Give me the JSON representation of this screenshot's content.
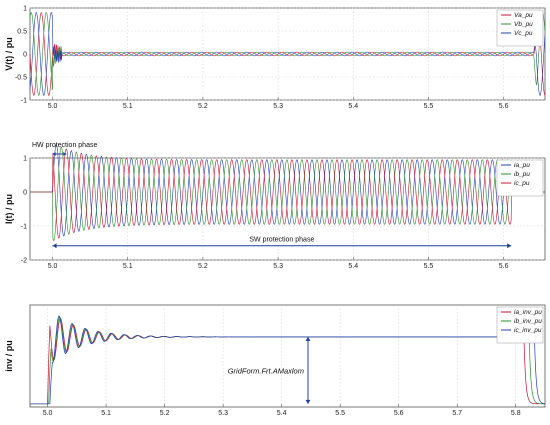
{
  "colors": {
    "a": "#c8102e",
    "b": "#2e8b2e",
    "c": "#1f3fb5",
    "arrow": "#1f3f9f",
    "grid": "#cccccc",
    "frame": "#555555"
  },
  "chart_data": [
    {
      "type": "line",
      "ylabel": "V(t) / pu",
      "xlim": [
        4.97,
        5.655
      ],
      "ylim": [
        -1,
        1
      ],
      "xticks": [
        5.0,
        5.1,
        5.2,
        5.3,
        5.4,
        5.5,
        5.6
      ],
      "yticks": [
        1,
        0.5,
        0,
        -0.5,
        -1
      ],
      "legend": "top-right",
      "series": [
        {
          "name": "Va_pu",
          "color": "#c8102e",
          "phase_deg": 0
        },
        {
          "name": "Vb_pu",
          "color": "#2e8b2e",
          "phase_deg": -120
        },
        {
          "name": "Vc_pu",
          "color": "#1f3fb5",
          "phase_deg": 120
        }
      ],
      "description_values": {
        "pre_fault_amplitude": 0.9,
        "fault_start": 5.0,
        "fault_amplitude": 0.04,
        "recovery_time": 5.64,
        "frequency_hz": 50
      }
    },
    {
      "type": "line",
      "ylabel": "I(t) / pu",
      "xlim": [
        4.97,
        5.655
      ],
      "ylim": [
        -2,
        1
      ],
      "xticks": [
        5.0,
        5.1,
        5.2,
        5.3,
        5.4,
        5.5,
        5.6
      ],
      "yticks": [
        1,
        0,
        -1,
        -2
      ],
      "legend": "top-right",
      "series": [
        {
          "name": "ia_pu",
          "color": "#1f3fb5",
          "phase_deg": 0
        },
        {
          "name": "ib_pu",
          "color": "#2e8b2e",
          "phase_deg": -120
        },
        {
          "name": "ic_pu",
          "color": "#c8102e",
          "phase_deg": 120
        }
      ],
      "description_values": {
        "fault_start": 5.0,
        "initial_peak": 1.45,
        "steady_amplitude": 0.95,
        "end": 5.61
      },
      "annotations": [
        {
          "text": "HW protection phase",
          "x_start": 5.0,
          "x_end": 5.013
        },
        {
          "text": "SW protection phase",
          "x_start": 5.0,
          "x_end": 5.61
        }
      ]
    },
    {
      "type": "line",
      "ylabel": "inv / pu",
      "xlim": [
        4.97,
        5.85
      ],
      "ylim": [
        0.2,
        1.8
      ],
      "xticks": [
        5.0,
        5.1,
        5.2,
        5.3,
        5.4,
        5.5,
        5.6,
        5.7,
        5.8
      ],
      "legend": "top-right",
      "series": [
        {
          "name": "ia_inv_pu",
          "color": "#c8102e",
          "drop_time": 5.814
        },
        {
          "name": "ib_inv_pu",
          "color": "#2e8b2e",
          "drop_time": 5.823
        },
        {
          "name": "ic_inv_pu",
          "color": "#1f3fb5",
          "drop_time": 5.832
        }
      ],
      "description_values": {
        "base_level": 0.25,
        "rise_time": 5.0,
        "peak": 1.75,
        "settled_level": 1.3
      },
      "annotations": [
        {
          "text": "GridForm.Frt.AMaxlom",
          "x": 5.445,
          "y_from": 0.25,
          "y_to": 1.3
        }
      ]
    }
  ]
}
